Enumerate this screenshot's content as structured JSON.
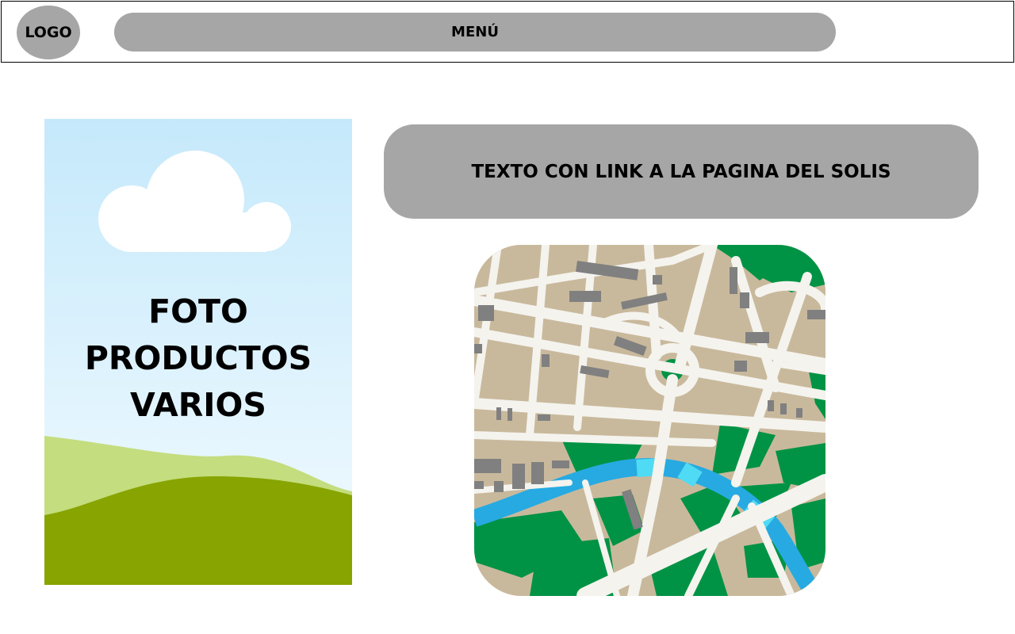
{
  "header": {
    "logo_label": "LOGO",
    "menu_label": "MENÚ"
  },
  "photo_placeholder": {
    "lines": [
      "FOTO",
      "PRODUCTOS",
      "VARIOS"
    ],
    "icon": "landscape-image-icon"
  },
  "link_box": {
    "label": "TEXTO CON LINK A LA PAGINA DEL SOLIS"
  },
  "map": {
    "icon": "city-map-icon"
  },
  "colors": {
    "placeholder_gray": "#a6a6a6",
    "sky_top": "#c5e9fb",
    "grass_light": "#c4dd7e",
    "grass_dark": "#87a400",
    "map_block": "#c9b99c",
    "map_road": "#f4f3ee",
    "map_park": "#009345",
    "map_river": "#27aae1",
    "map_building": "#808080"
  }
}
